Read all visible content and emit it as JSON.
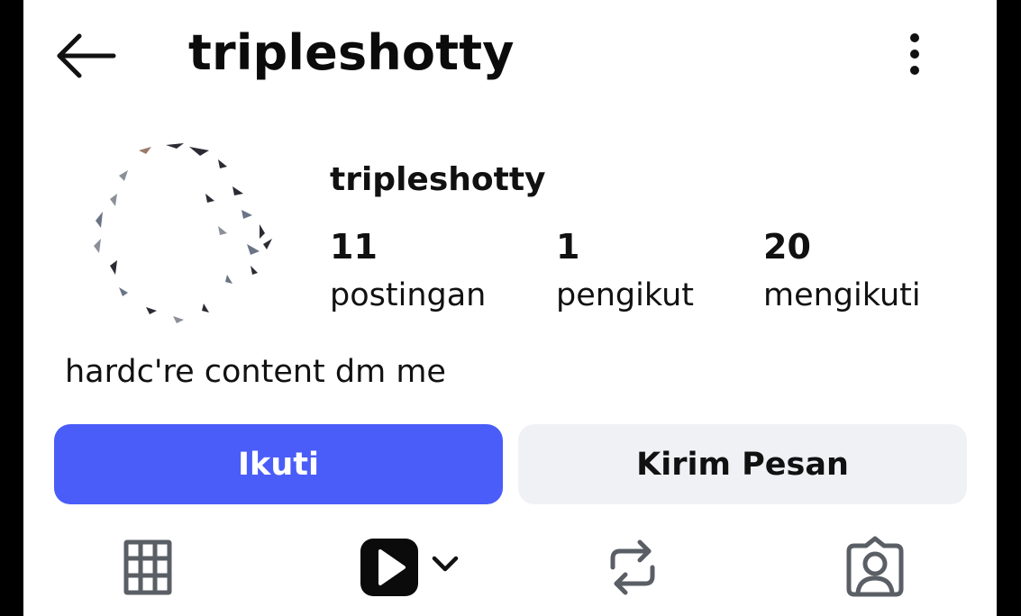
{
  "header": {
    "title": "tripleshotty",
    "back_icon": "arrow-left-icon",
    "more_icon": "more-vertical-icon"
  },
  "profile": {
    "name": "tripleshotty",
    "avatar_icon": "avatar",
    "bio": "hardc're content dm me",
    "stats": [
      {
        "value": "11",
        "label": "postingan"
      },
      {
        "value": "1",
        "label": "pengikut"
      },
      {
        "value": "20",
        "label": "mengikuti"
      }
    ]
  },
  "actions": {
    "follow_label": "Ikuti",
    "message_label": "Kirim Pesan"
  },
  "tabs": [
    {
      "icon": "grid-icon"
    },
    {
      "icon": "reels-play-icon"
    },
    {
      "icon": "reposts-icon"
    },
    {
      "icon": "tagged-person-icon"
    }
  ],
  "colors": {
    "accent": "#4a5df9",
    "secondary_button": "#eff1f5",
    "text": "#111111",
    "icon_gray": "#5a5f66"
  }
}
